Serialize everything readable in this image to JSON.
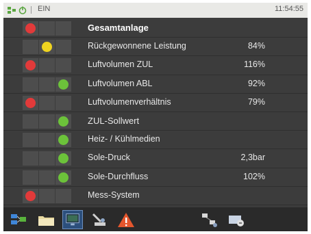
{
  "statusbar": {
    "mode": "EIN",
    "time": "11:54:55",
    "icons": [
      "network-icon",
      "power-icon"
    ]
  },
  "status_colors": {
    "red": "#e23a3a",
    "yellow": "#f0d420",
    "green": "#6cc23a"
  },
  "rows": [
    {
      "label": "Gesamtanlage",
      "value": "",
      "status": "red",
      "heading": true
    },
    {
      "label": "Rückgewonnene Leistung",
      "value": "84%",
      "status": "yellow"
    },
    {
      "label": "Luftvolumen ZUL",
      "value": "116%",
      "status": "red"
    },
    {
      "label": "Luftvolumen ABL",
      "value": "92%",
      "status": "green"
    },
    {
      "label": "Luftvolumenverhältnis",
      "value": "79%",
      "status": "red"
    },
    {
      "label": "ZUL-Sollwert",
      "value": "",
      "status": "green",
      "heading_like": true
    },
    {
      "label": "Heiz- / Kühlmedien",
      "value": "",
      "status": "green"
    },
    {
      "label": "Sole-Druck",
      "value": "2,3bar",
      "status": "green"
    },
    {
      "label": "Sole-Durchfluss",
      "value": "102%",
      "status": "green"
    },
    {
      "label": "Mess-System",
      "value": "",
      "status": "red"
    }
  ],
  "toolbar": {
    "buttons": [
      {
        "name": "plant-overview-icon"
      },
      {
        "name": "folder-icon"
      },
      {
        "name": "monitor-icon",
        "selected": true
      },
      {
        "name": "service-tool-icon"
      },
      {
        "name": "alarm-warning-icon"
      },
      {
        "name": "network-nodes-icon"
      },
      {
        "name": "transfer-icon"
      }
    ]
  }
}
